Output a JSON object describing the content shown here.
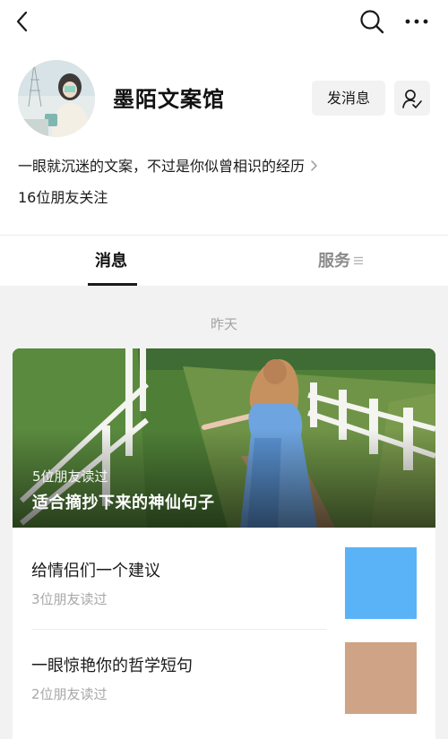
{
  "account": {
    "name": "墨陌文案馆",
    "intro": "一眼就沉迷的文案，不过是你似曾相识的经历",
    "followers": "16位朋友关注"
  },
  "actions": {
    "message_label": "发消息"
  },
  "icons": {
    "back": "chevron-left-icon",
    "search": "search-icon",
    "more": "more-dots-icon",
    "follow": "user-check-icon",
    "intro_more": "chevron-right-icon",
    "services_menu": "menu-icon"
  },
  "tabs": [
    {
      "label": "消息",
      "active": true
    },
    {
      "label": "服务",
      "active": false
    }
  ],
  "feed": {
    "date": "昨天",
    "cover_article": {
      "reads": "5位朋友读过",
      "title": "适合摘抄下来的神仙句子"
    },
    "articles": [
      {
        "title": "给情侣们一个建议",
        "reads": "3位朋友读过",
        "thumb_color": "#5ab3f7"
      },
      {
        "title": "一眼惊艳你的哲学短句",
        "reads": "2位朋友读过",
        "thumb_color": "#cfa486"
      }
    ]
  },
  "colors": {
    "tab_active": "#111111",
    "tab_inactive": "#8a8a8a",
    "secondary_text": "#a8a8a8",
    "page_background": "#f2f2f2"
  }
}
